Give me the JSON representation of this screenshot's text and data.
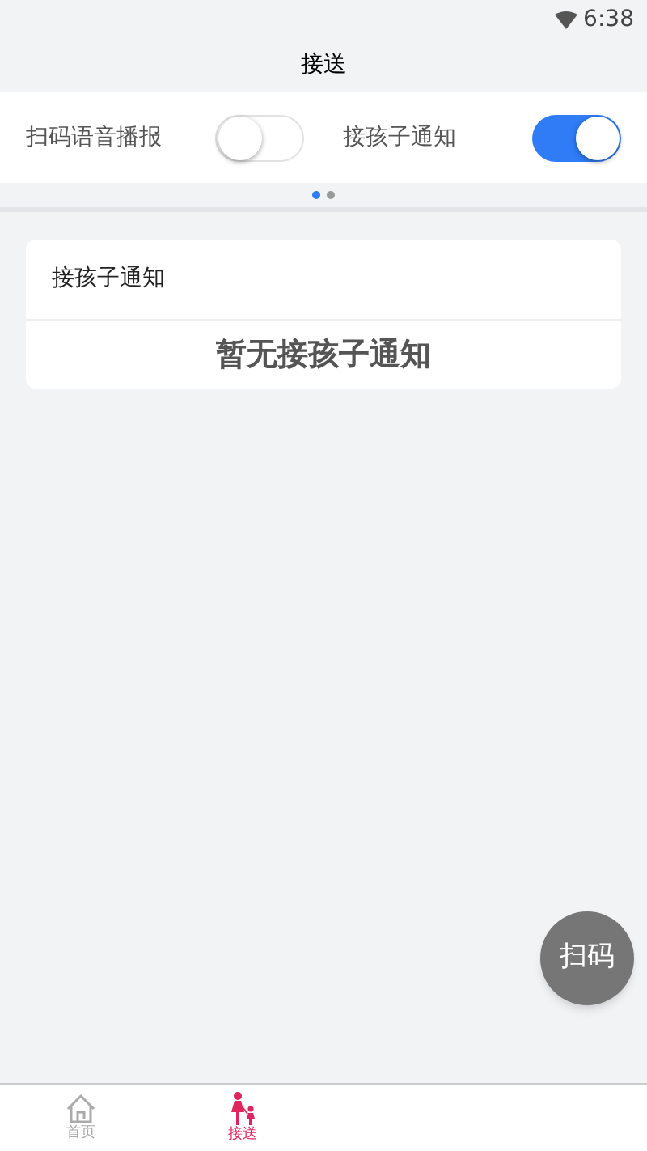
{
  "status_bar": {
    "time": "6:38"
  },
  "header": {
    "title": "接送"
  },
  "switches": [
    {
      "label": "扫码语音播报",
      "on": false
    },
    {
      "label": "接孩子通知",
      "on": true
    }
  ],
  "pager": [
    {
      "selected": true
    },
    {
      "selected": false
    }
  ],
  "card": {
    "title": "接孩子通知",
    "empty_text": "暂无接孩子通知"
  },
  "fab": {
    "label": "扫码"
  },
  "tabs": [
    {
      "label": "首页",
      "kind": "home",
      "selected": false
    },
    {
      "label": "接送",
      "kind": "pickup",
      "selected": true
    }
  ]
}
